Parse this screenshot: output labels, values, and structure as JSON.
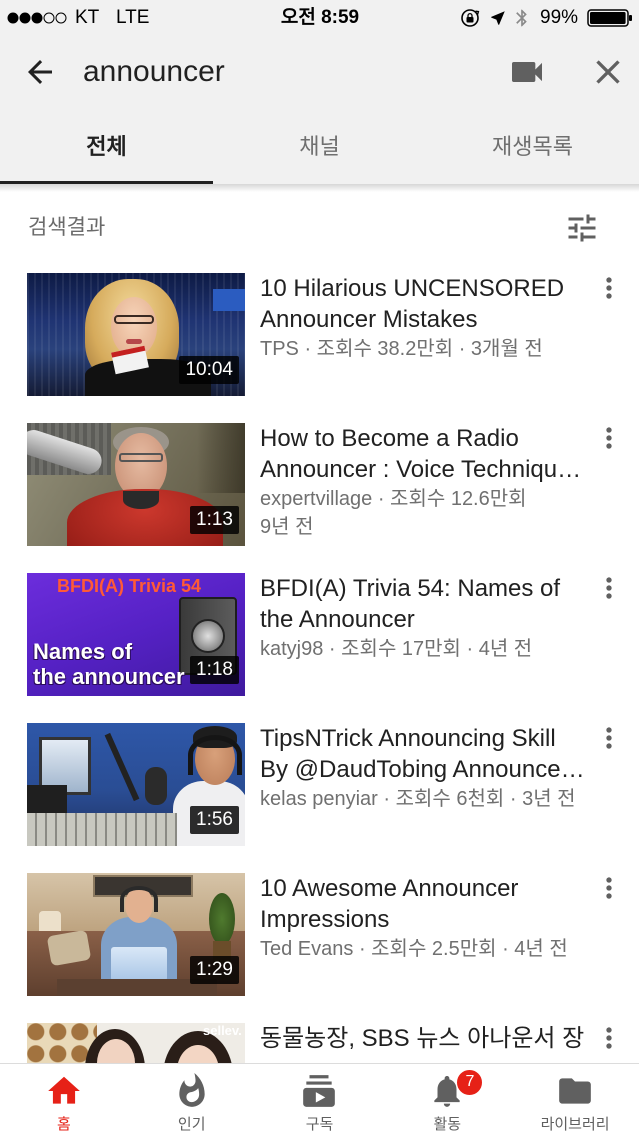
{
  "status_bar": {
    "signal": {
      "filled": 3,
      "total": 5
    },
    "carrier": "KT",
    "network": "LTE",
    "time": "오전 8:59",
    "battery_text": "99%",
    "battery_level": 0.99,
    "icons": [
      "rotation-lock-icon",
      "location-arrow-icon",
      "bluetooth-icon",
      "battery-icon"
    ]
  },
  "search": {
    "query": "announcer",
    "icons": {
      "back": "arrow-back-icon",
      "camera": "videocam-icon",
      "close": "close-icon"
    }
  },
  "tabs": [
    {
      "label": "전체",
      "active": true
    },
    {
      "label": "채널",
      "active": false
    },
    {
      "label": "재생목록",
      "active": false
    }
  ],
  "results": {
    "label": "검색결과",
    "filter_icon": "tune-icon",
    "more_icon": "more-vert-icon"
  },
  "videos": [
    {
      "title_lines": [
        "10 Hilarious UNCENSORED",
        "Announcer Mistakes"
      ],
      "meta_lines": [
        "TPS · 조회수 38.2만회 · 3개월 전"
      ],
      "duration": "10:04"
    },
    {
      "title_lines": [
        "How to Become a Radio",
        "Announcer : Voice Techniqu…"
      ],
      "meta_lines": [
        "expertvillage · 조회수 12.6만회",
        "9년 전"
      ],
      "duration": "1:13"
    },
    {
      "title_lines": [
        "BFDI(A) Trivia 54: Names of",
        "the Announcer"
      ],
      "meta_lines": [
        "katyj98 · 조회수 17만회 · 4년 전"
      ],
      "duration": "1:18",
      "thumbnail_text": [
        "BFDI(A) Trivia 54",
        "Names of",
        "the announcer"
      ]
    },
    {
      "title_lines": [
        "TipsNTrick Announcing Skill",
        "By @DaudTobing Announce…"
      ],
      "meta_lines": [
        "kelas penyiar · 조회수 6천회 · 3년 전"
      ],
      "duration": "1:56"
    },
    {
      "title_lines": [
        "10 Awesome Announcer",
        "Impressions"
      ],
      "meta_lines": [
        "Ted Evans · 조회수 2.5만회 · 4년 전"
      ],
      "duration": "1:29"
    },
    {
      "title_lines": [
        "동물농장, SBS 뉴스 아나운서 장"
      ],
      "thumbnail_text": [
        "sellev."
      ]
    }
  ],
  "bottom_nav": [
    {
      "label": "홈",
      "icon": "home-icon",
      "active": true
    },
    {
      "label": "인기",
      "icon": "flame-icon",
      "active": false
    },
    {
      "label": "구독",
      "icon": "subscriptions-icon",
      "active": false
    },
    {
      "label": "활동",
      "icon": "bell-icon",
      "active": false,
      "badge": "7"
    },
    {
      "label": "라이브러리",
      "icon": "folder-icon",
      "active": false
    }
  ],
  "colors": {
    "accent": "#e62117",
    "header_bg": "#f1f1f1",
    "text_primary": "#212121",
    "text_secondary": "#707070",
    "icon": "#606060"
  }
}
